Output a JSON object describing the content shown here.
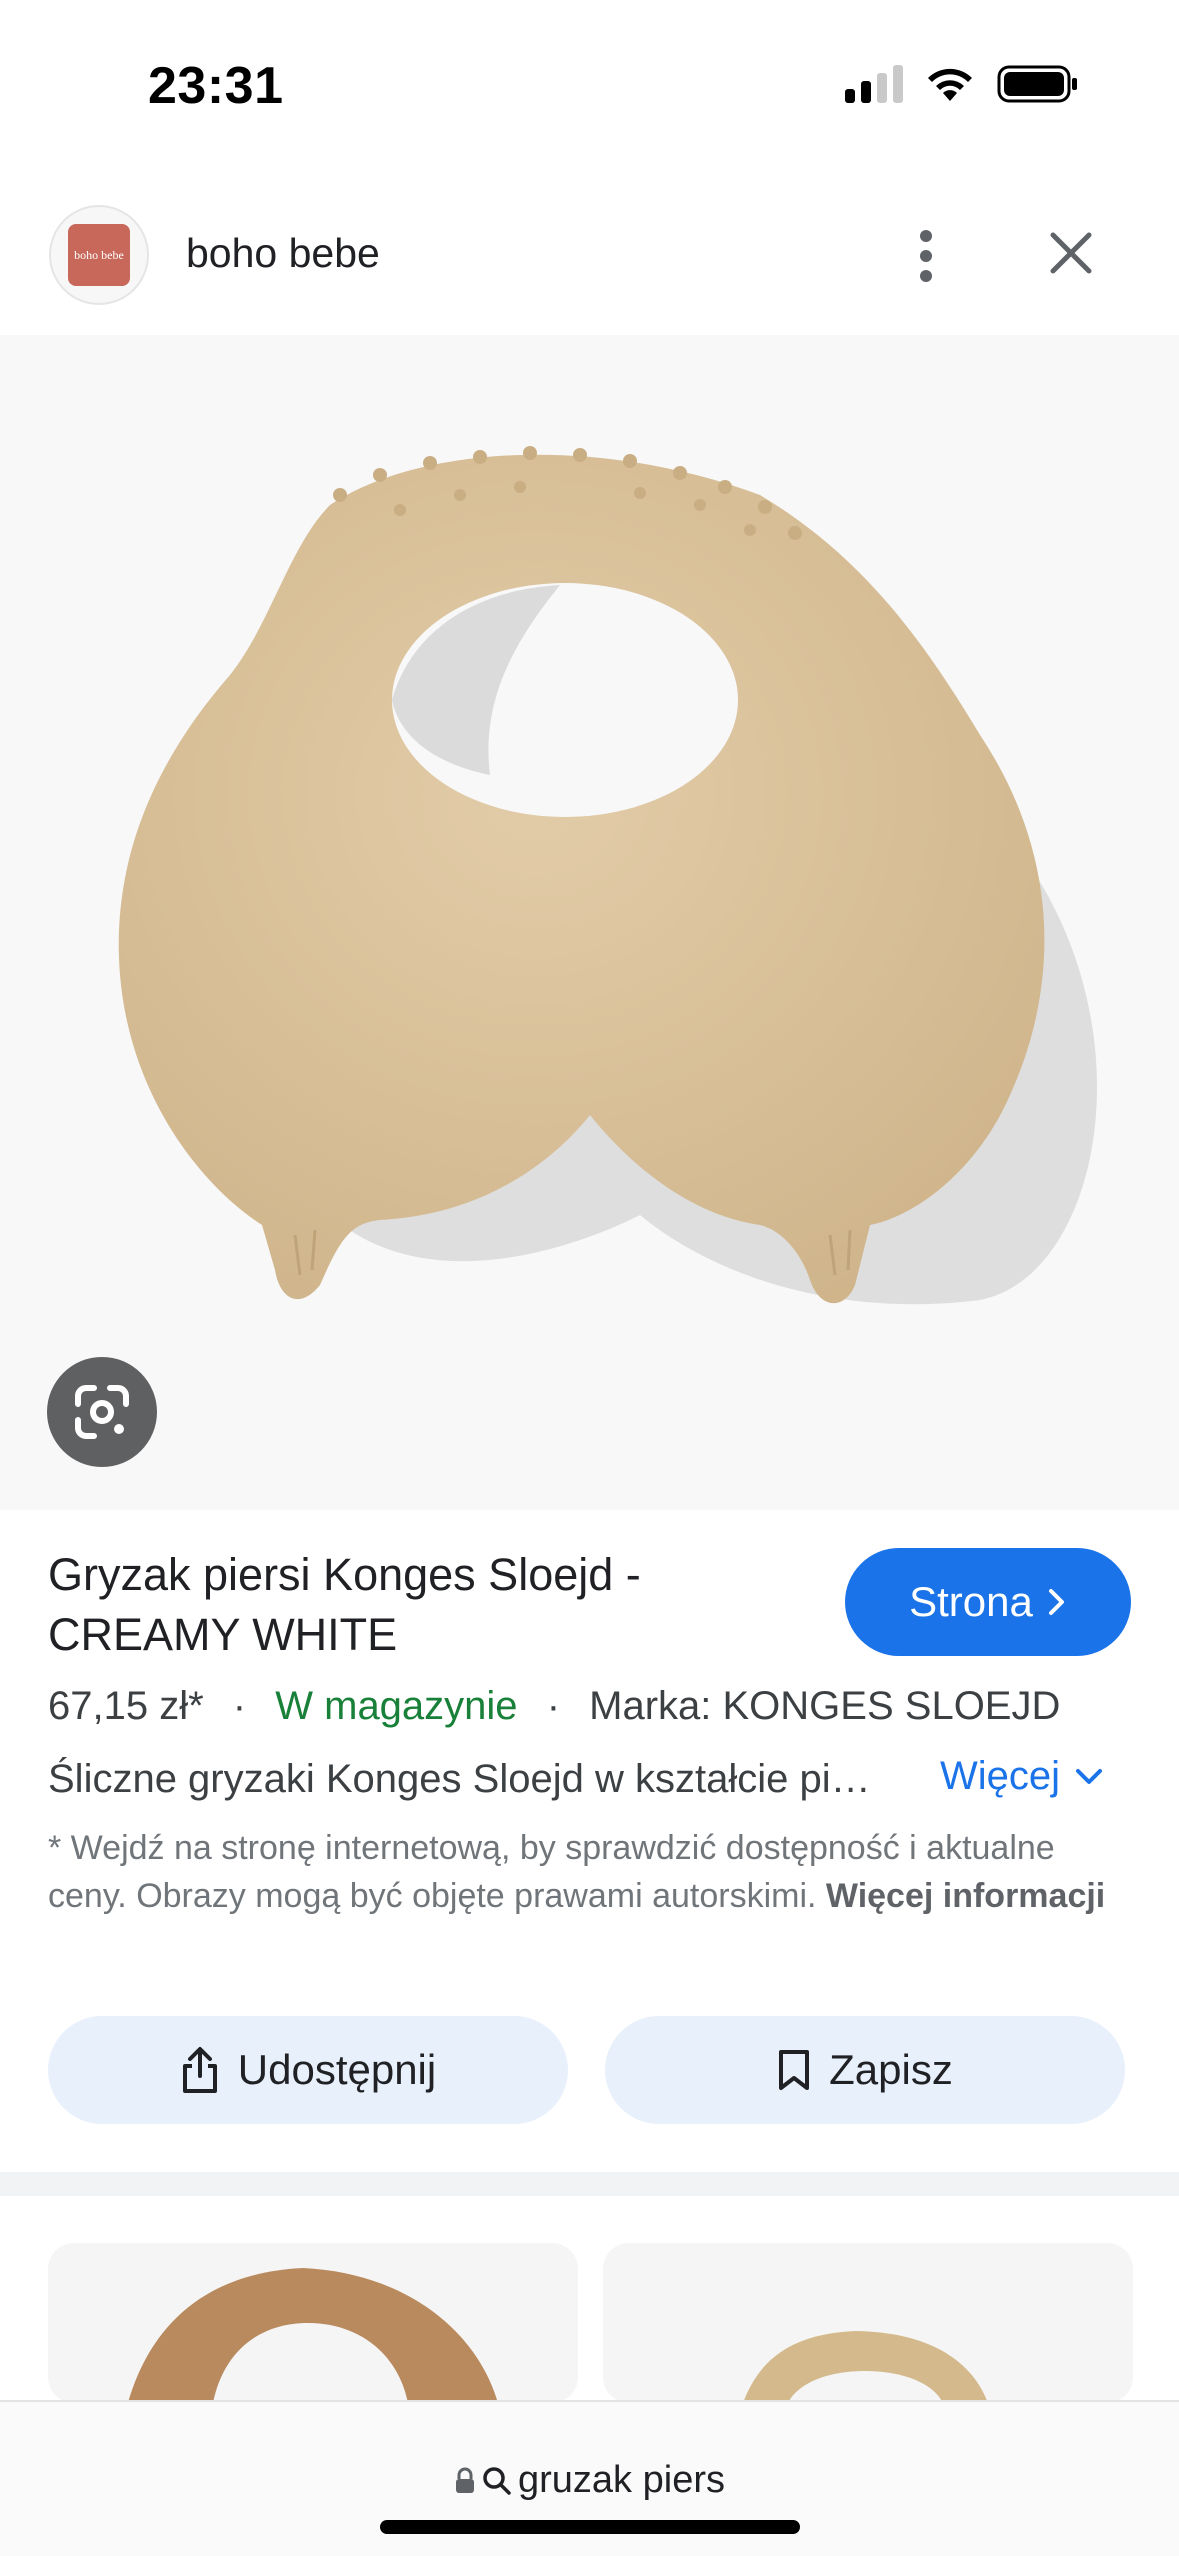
{
  "status_bar": {
    "time": "23:31",
    "icons": [
      "cellular-signal-icon",
      "wifi-icon",
      "battery-icon"
    ]
  },
  "header": {
    "site_name": "boho bebe",
    "logo_text": "boho bebe",
    "icons": [
      "more-vert-icon",
      "close-icon"
    ]
  },
  "image": {
    "lens_icon": "google-lens-icon"
  },
  "product": {
    "title": "Gryzak piersi Konges Sloejd - CREAMY WHITE",
    "visit_label": "Strona",
    "price": "67,15 zł*",
    "stock": "W magazynie",
    "brand": "Marka: KONGES SLOEJD",
    "separator": "·",
    "description": "Śliczne gryzaki Konges Sloejd w kształcie piersi",
    "more_label": "Więcej",
    "disclaimer_text": "* Wejdź na stronę internetową, by sprawdzić dostępność i aktualne ceny. Obrazy mogą być objęte prawami autorskimi.",
    "disclaimer_link": "Więcej informacji"
  },
  "actions": {
    "share_label": "Udostępnij",
    "save_label": "Zapisz"
  },
  "address_bar": {
    "query": "gruzak piers"
  },
  "colors": {
    "accent": "#1a73e8",
    "stock_green": "#188038",
    "product_beige": "#d9c29f",
    "button_bg": "#e8f0fb"
  }
}
